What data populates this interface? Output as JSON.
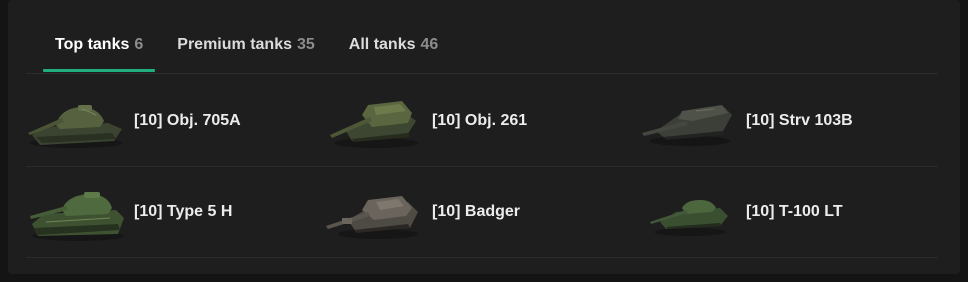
{
  "tabs": [
    {
      "label": "Top tanks",
      "count": "6"
    },
    {
      "label": "Premium tanks",
      "count": "35"
    },
    {
      "label": "All tanks",
      "count": "46"
    }
  ],
  "active_tab_accent": "#1fae7c",
  "tanks": [
    {
      "name": "[10] Obj. 705A",
      "icon": "heavy-tank-icon",
      "color": "#46503a"
    },
    {
      "name": "[10] Obj. 261",
      "icon": "artillery-tank-icon",
      "color": "#4c5636"
    },
    {
      "name": "[10] Strv 103B",
      "icon": "tank-destroyer-icon",
      "color": "#3a3d36"
    },
    {
      "name": "[10] Type 5 H",
      "icon": "heavy-tank-icon",
      "color": "#435a38"
    },
    {
      "name": "[10] Badger",
      "icon": "tank-destroyer-icon",
      "color": "#5e5852"
    },
    {
      "name": "[10] T-100 LT",
      "icon": "light-tank-icon",
      "color": "#3f5534"
    }
  ]
}
